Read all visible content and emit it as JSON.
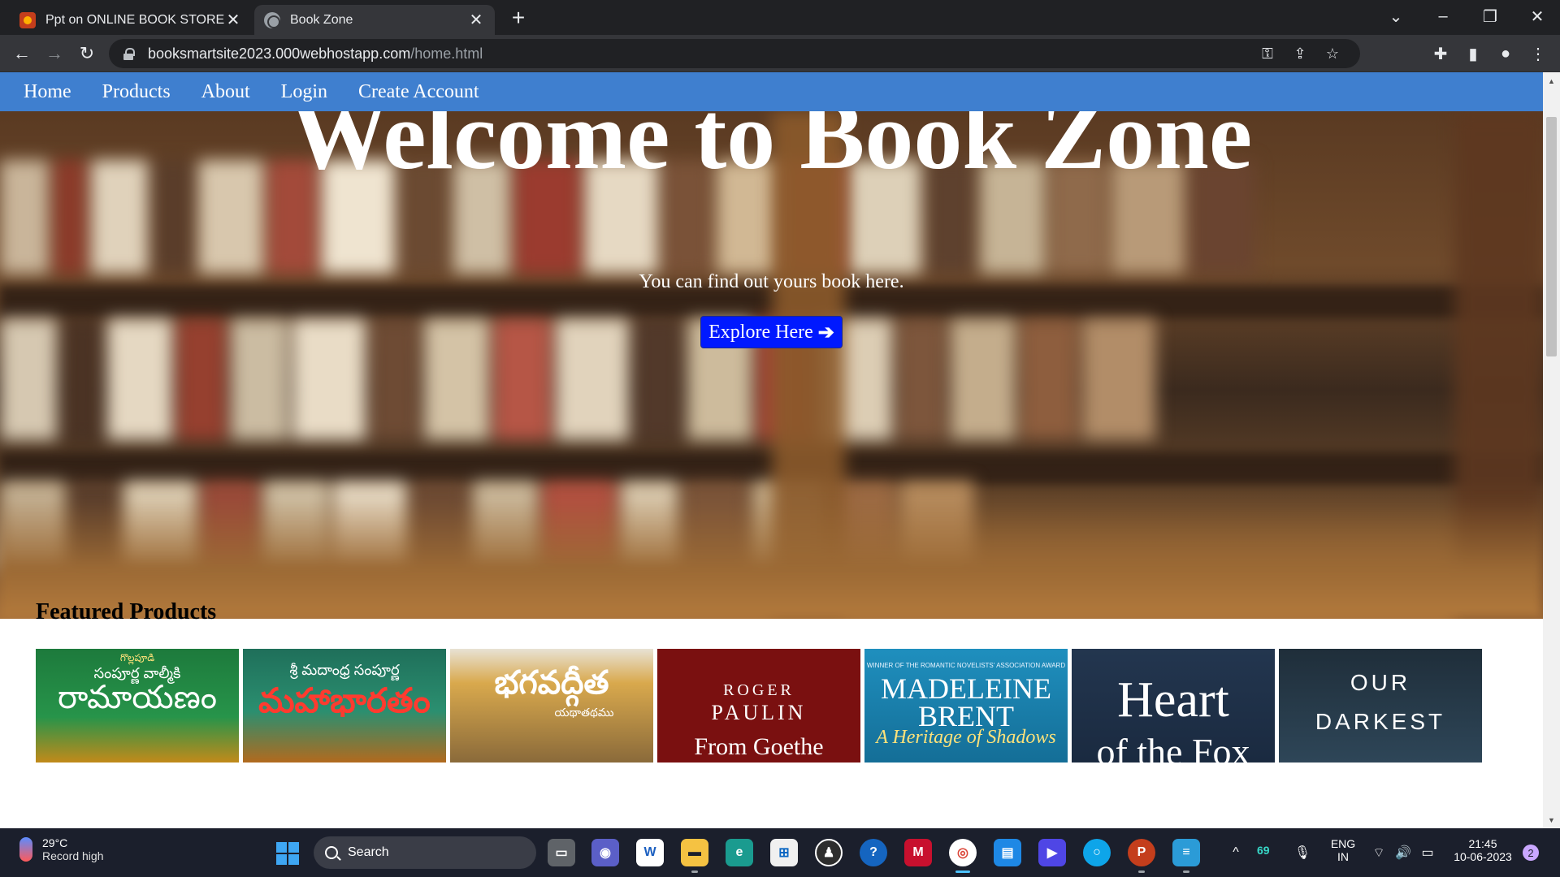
{
  "browser": {
    "tabs": [
      {
        "title": "Ppt on ONLINE BOOK STORE",
        "favicon": "powerpoint-icon",
        "active": false
      },
      {
        "title": "Book Zone",
        "favicon": "globe-icon",
        "active": true
      }
    ],
    "url_host": "booksmartsite2023.000webhostapp.com",
    "url_path": "/home.html"
  },
  "site": {
    "nav": [
      "Home",
      "Products",
      "About",
      "Login",
      "Create Account"
    ],
    "hero": {
      "title": "Welcome to Book Zone",
      "subtitle": "You can find out yours book here.",
      "button": "Explore Here",
      "button_icon": "arrow-right-icon"
    },
    "featured": {
      "title": "Featured Products",
      "books": [
        {
          "small": "గొల్లపూడి",
          "line1": "సంపూర్ణ వాల్మీకి",
          "title": "రామాయణం",
          "color": "#27944a"
        },
        {
          "small": "",
          "line1": "శ్రీ మదాంధ్ర సంపూర్ణ",
          "title": "మహాభారతం",
          "color": "#2b8f70"
        },
        {
          "small": "",
          "line1": "",
          "title": "భగవద్గీత",
          "subtitle": "యథాతథము",
          "color": "#d9a94d"
        },
        {
          "small": "ROGER",
          "line1": "PAULIN",
          "title": "From Goethe",
          "color": "#7a1010"
        },
        {
          "small": "WINNER OF THE ROMANTIC NOVELISTS' ASSOCIATION AWARD",
          "line1": "MADELEINE",
          "title": "BRENT",
          "subtitle": "A Heritage of Shadows",
          "color": "#1f8fbe"
        },
        {
          "small": "",
          "line1": "Heart",
          "title": "of the Fox",
          "color": "#23364f"
        },
        {
          "small": "",
          "line1": "OUR",
          "title": "DARKEST",
          "color": "#1f2e3a"
        }
      ]
    }
  },
  "taskbar": {
    "weather_temp": "29°C",
    "weather_desc": "Record high",
    "search_label": "Search",
    "counter": "69",
    "lang": "ENG",
    "region": "IN",
    "time": "21:45",
    "date": "10-06-2023",
    "notifications": "2"
  },
  "colors": {
    "site_nav": "#3f7fcf",
    "explore_button": "#0019ff",
    "browser_dark": "#202124",
    "taskbar": "#1b1f2c"
  }
}
